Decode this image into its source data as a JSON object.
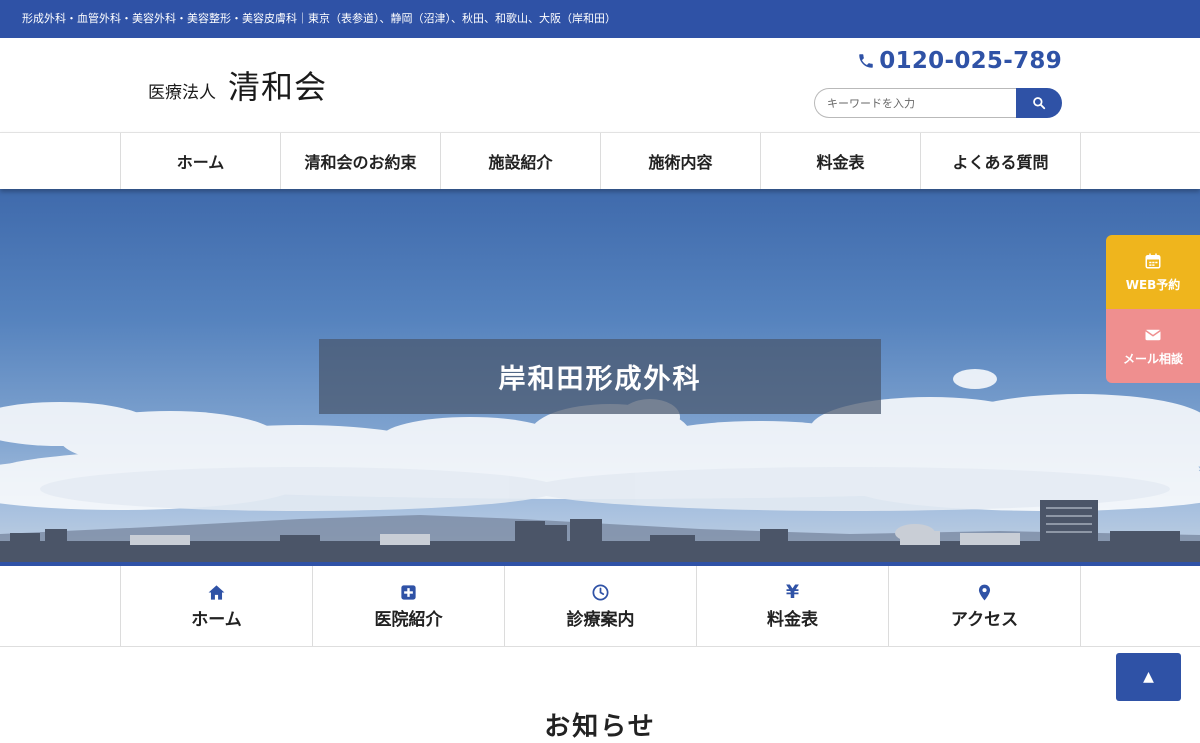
{
  "topbar": {
    "text": "形成外科・血管外科・美容外科・美容整形・美容皮膚科｜東京（表参道）、静岡（沼津）、秋田、和歌山、大阪（岸和田）"
  },
  "header": {
    "logo_org": "医療法人",
    "logo_name": "清和会",
    "phone": "0120-025-789",
    "search_placeholder": "キーワードを入力"
  },
  "main_nav": [
    {
      "label": "ホーム"
    },
    {
      "label": "清和会のお約束"
    },
    {
      "label": "施設紹介"
    },
    {
      "label": "施術内容"
    },
    {
      "label": "料金表"
    },
    {
      "label": "よくある質問"
    }
  ],
  "hero": {
    "title": "岸和田形成外科"
  },
  "side_buttons": {
    "web_label": "WEB予約",
    "mail_label": "メール相談"
  },
  "sub_nav": [
    {
      "label": "ホーム",
      "icon": "home-icon"
    },
    {
      "label": "医院紹介",
      "icon": "medical-cross-icon"
    },
    {
      "label": "診療案内",
      "icon": "clock-icon"
    },
    {
      "label": "料金表",
      "icon": "yen-icon",
      "glyph": "¥"
    },
    {
      "label": "アクセス",
      "icon": "map-pin-icon"
    }
  ],
  "back_to_top": {
    "glyph": "▲"
  },
  "news": {
    "title": "お知らせ"
  },
  "colors": {
    "brand_blue": "#2f52a6",
    "web_yellow": "#efb51d",
    "mail_pink": "#ef8f8f"
  }
}
